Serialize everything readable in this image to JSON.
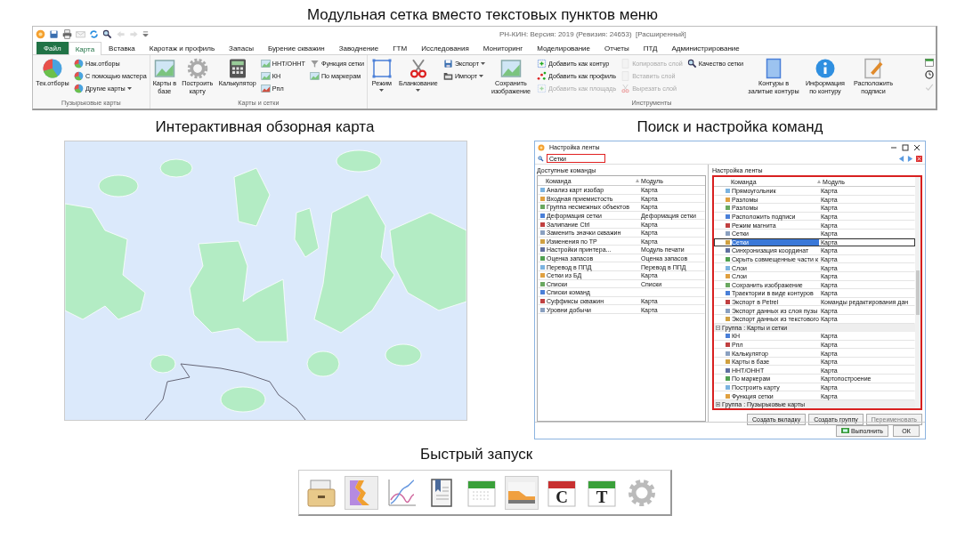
{
  "heading": "Модульная сетка вместо текстовых пунктов меню",
  "ribbon": {
    "title": "РН-КИН: Версия: 2019 (Ревизия: 24653)  [Расширенный]",
    "file_tab": "Файл",
    "tabs": [
      {
        "label": "Карта",
        "selected": true
      },
      {
        "label": "Вставка",
        "selected": false
      },
      {
        "label": "Каротаж и профиль",
        "selected": false
      },
      {
        "label": "Запасы",
        "selected": false
      },
      {
        "label": "Бурение скважин",
        "selected": false
      },
      {
        "label": "Заводнение",
        "selected": false
      },
      {
        "label": "ГТМ",
        "selected": false
      },
      {
        "label": "Исследования",
        "selected": false
      },
      {
        "label": "Мониторинг",
        "selected": false
      },
      {
        "label": "Моделирование",
        "selected": false
      },
      {
        "label": "Отчеты",
        "selected": false
      },
      {
        "label": "ПТД",
        "selected": false
      },
      {
        "label": "Администрирование",
        "selected": false
      }
    ],
    "groups": [
      {
        "label": "Пузырьковые карты",
        "columns": [
          {
            "kind": "large",
            "items": [
              {
                "label": "Тек.отборы",
                "disabled": false,
                "dropdown": false
              }
            ]
          },
          {
            "kind": "stack",
            "items": [
              {
                "label": "Нак.отборы",
                "disabled": false,
                "dropdown": false
              },
              {
                "label": "С помощью мастера",
                "disabled": false,
                "dropdown": false
              },
              {
                "label": "Другие карты",
                "disabled": false,
                "dropdown": true
              }
            ]
          }
        ]
      },
      {
        "label": "Карты и сетки",
        "columns": [
          {
            "kind": "large",
            "items": [
              {
                "label": "Карты в базе",
                "disabled": false,
                "dropdown": false
              }
            ]
          },
          {
            "kind": "large",
            "items": [
              {
                "label": "Построить карту",
                "disabled": false,
                "dropdown": false
              }
            ]
          },
          {
            "kind": "large",
            "items": [
              {
                "label": "Калькулятор",
                "disabled": false,
                "dropdown": false
              }
            ]
          },
          {
            "kind": "stack",
            "items": [
              {
                "label": "НHT/ОНHT",
                "disabled": false,
                "dropdown": false
              },
              {
                "label": "КН",
                "disabled": false,
                "dropdown": false
              },
              {
                "label": "Рпл",
                "disabled": false,
                "dropdown": false
              }
            ]
          },
          {
            "kind": "stack",
            "items": [
              {
                "label": "Функция сетки",
                "disabled": false,
                "dropdown": false
              },
              {
                "label": "По маркерам",
                "disabled": false,
                "dropdown": false
              }
            ]
          }
        ]
      },
      {
        "label": "Инструменты",
        "columns": [
          {
            "kind": "large",
            "items": [
              {
                "label": "Режим",
                "disabled": false,
                "dropdown": true
              }
            ]
          },
          {
            "kind": "large",
            "items": [
              {
                "label": "Бланкование",
                "disabled": false,
                "dropdown": true
              }
            ]
          },
          {
            "kind": "stack",
            "items": [
              {
                "label": "Экспорт",
                "disabled": false,
                "dropdown": true
              },
              {
                "label": "Импорт",
                "disabled": false,
                "dropdown": true
              }
            ]
          },
          {
            "kind": "large",
            "items": [
              {
                "label": "Сохранить изображение",
                "disabled": false,
                "dropdown": false
              }
            ]
          },
          {
            "kind": "stack",
            "items": [
              {
                "label": "Добавить как контур",
                "disabled": false,
                "dropdown": false
              },
              {
                "label": "Добавить как профиль",
                "disabled": false,
                "dropdown": false
              },
              {
                "label": "Добавить как площадь",
                "disabled": true,
                "dropdown": false
              }
            ]
          },
          {
            "kind": "stack",
            "items": [
              {
                "label": "Копировать слой",
                "disabled": true,
                "dropdown": false
              },
              {
                "label": "Вставить слой",
                "disabled": true,
                "dropdown": false
              },
              {
                "label": "Вырезать слой",
                "disabled": true,
                "dropdown": false
              }
            ]
          },
          {
            "kind": "stack",
            "items": [
              {
                "label": "Качество сетки",
                "disabled": false,
                "dropdown": false
              }
            ]
          },
          {
            "kind": "large",
            "items": [
              {
                "label": "Контуры в залитые контуры",
                "disabled": false,
                "dropdown": false
              }
            ]
          },
          {
            "kind": "large",
            "items": [
              {
                "label": "Информация по контуру",
                "disabled": false,
                "dropdown": false
              }
            ]
          },
          {
            "kind": "large",
            "items": [
              {
                "label": "Расположить подписи",
                "disabled": false,
                "dropdown": false
              }
            ]
          }
        ]
      }
    ]
  },
  "overview_map": {
    "caption": "Интерактивная обзорная карта",
    "kind": "picture"
  },
  "ribbon_settings": {
    "caption": "Поиск и настройка команд",
    "title": "Настройка ленты",
    "search": {
      "value": "Сетки"
    },
    "available": {
      "label": "Доступные команды",
      "columns": [
        "Команда",
        "Модуль"
      ],
      "rows": [
        {
          "command": "Анализ карт изобар",
          "module": "Карта",
          "selected": false
        },
        {
          "command": "Входная приемистость",
          "module": "Карта",
          "selected": false
        },
        {
          "command": "Группа несмежных объектов",
          "module": "Карта",
          "selected": false
        },
        {
          "command": "Деформация сетки",
          "module": "Деформация сетки",
          "selected": false
        },
        {
          "command": "Залипание Ctrl",
          "module": "Карта",
          "selected": false
        },
        {
          "command": "Заменить значки скважин",
          "module": "Карта",
          "selected": false
        },
        {
          "command": "Изменения по ТР",
          "module": "Карта",
          "selected": false
        },
        {
          "command": "Настройки принтера...",
          "module": "Модуль печати",
          "selected": false
        },
        {
          "command": "Оценка запасов",
          "module": "Оценка запасов",
          "selected": false
        },
        {
          "command": "Перевод в ППД",
          "module": "Перевод в ППД",
          "selected": false
        },
        {
          "command": "Сетки из БД",
          "module": "Карта",
          "selected": false
        },
        {
          "command": "Списки",
          "module": "Списки",
          "selected": false
        },
        {
          "command": "Списки команд",
          "selected": false
        },
        {
          "command": "Суффиксы скважин",
          "module": "Карта",
          "selected": false
        },
        {
          "command": "Уровни добычи",
          "module": "Карта",
          "selected": false
        }
      ]
    },
    "ribbon_layout": {
      "label": "Настройка ленты",
      "columns": [
        "Команда",
        "Модуль"
      ],
      "rows": [
        {
          "kind": "command",
          "command": "Прямоугольник",
          "module": "Карта",
          "selected": false
        },
        {
          "kind": "command",
          "command": "Разломы",
          "module": "Карта",
          "selected": false
        },
        {
          "kind": "command",
          "command": "Разломы",
          "module": "Карта",
          "selected": false
        },
        {
          "kind": "command",
          "command": "Расположить подписи",
          "module": "Карта",
          "selected": false
        },
        {
          "kind": "command",
          "command": "Режим магнита",
          "module": "Карта",
          "selected": false
        },
        {
          "kind": "command",
          "command": "Сетки",
          "module": "Карта",
          "selected": false
        },
        {
          "kind": "command",
          "command": "Сетки",
          "module": "Карта",
          "selected": true
        },
        {
          "kind": "command",
          "command": "Синхронизация координат",
          "module": "Карта",
          "selected": false
        },
        {
          "kind": "command",
          "command": "Скрыть совмещенные части к",
          "module": "Карта",
          "selected": false
        },
        {
          "kind": "command",
          "command": "Слои",
          "module": "Карта",
          "selected": false
        },
        {
          "kind": "command",
          "command": "Слои",
          "module": "Карта",
          "selected": false
        },
        {
          "kind": "command",
          "command": "Сохранить изображение",
          "module": "Карта",
          "selected": false
        },
        {
          "kind": "command",
          "command": "Траектории в виде контуров",
          "module": "Карта",
          "selected": false
        },
        {
          "kind": "command",
          "command": "Экспорт в Petrel",
          "module": "Команды редактирования дан",
          "selected": false
        },
        {
          "kind": "command",
          "command": "Экспорт данных из слоя пузы",
          "module": "Карта",
          "selected": false
        },
        {
          "kind": "command",
          "command": "Экспорт данных из текстового",
          "module": "Карта",
          "selected": false
        },
        {
          "kind": "group",
          "label": "Группа : Карты и сетки",
          "expanded": true,
          "children": [
            {
              "command": "КН",
              "module": "Карта",
              "selected": false
            },
            {
              "command": "Рпл",
              "module": "Карта",
              "selected": false
            },
            {
              "command": "Калькулятор",
              "module": "Карта",
              "selected": false
            },
            {
              "command": "Карты в базе",
              "module": "Карта",
              "selected": false
            },
            {
              "command": "НHT/ОНHT",
              "module": "Карта",
              "selected": false
            },
            {
              "command": "По маркерам",
              "module": "Картопостроение",
              "selected": false
            },
            {
              "command": "Построить карту",
              "module": "Карта",
              "selected": false
            },
            {
              "command": "Функция сетки",
              "module": "Карта",
              "selected": false
            }
          ]
        },
        {
          "kind": "group",
          "label": "Группа : Пузырьковые карты",
          "expanded": false
        }
      ]
    },
    "buttons": [
      {
        "label": "Создать вкладку",
        "disabled": false
      },
      {
        "label": "Создать группу",
        "disabled": false
      },
      {
        "label": "Переименовать",
        "disabled": true
      }
    ],
    "footer_buttons": [
      "Выполнить",
      "ОК"
    ]
  },
  "quick_launch": {
    "caption": "Быстрый запуск",
    "icon_letters": [
      "C",
      "T"
    ]
  }
}
